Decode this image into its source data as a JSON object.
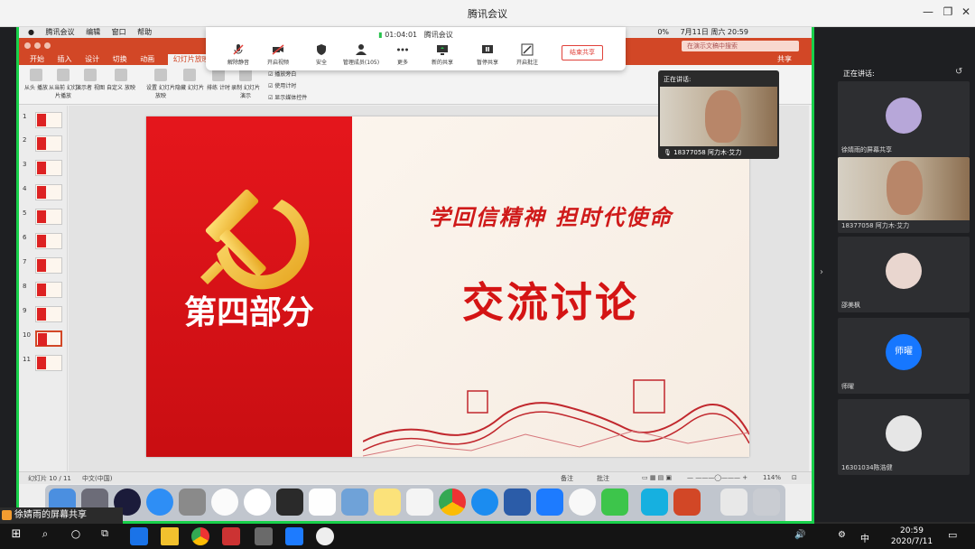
{
  "window": {
    "title": "腾讯会议"
  },
  "mac_menubar": {
    "items": [
      "腾讯会议",
      "编辑",
      "窗口",
      "帮助"
    ],
    "status": "0%",
    "datetime": "7月11日 周六  20:59"
  },
  "ppt": {
    "search_placeholder": "在演示文稿中搜索",
    "share_label": "共享",
    "tabs": [
      "开始",
      "插入",
      "设计",
      "切换",
      "动画",
      "幻灯片放映"
    ],
    "ribbon": [
      {
        "label": "从头\n播放"
      },
      {
        "label": "从当前\n幻灯片播放"
      },
      {
        "label": "演示者\n视图"
      },
      {
        "label": "自定义\n放映"
      },
      {
        "label": "设置\n幻灯片放映"
      },
      {
        "label": "隐藏\n幻灯片"
      },
      {
        "label": "排练\n计时"
      },
      {
        "label": "录制\n幻灯片演示"
      }
    ],
    "checkboxes": [
      "播放旁白",
      "使用计时",
      "显示媒体控件"
    ],
    "thumbnails": [
      "1",
      "2",
      "3",
      "4",
      "5",
      "6",
      "7",
      "8",
      "9",
      "10",
      "11"
    ],
    "selected_slide": 10,
    "status": {
      "slide_count": "幻灯片 10 / 11",
      "language": "中文(中国)",
      "notes": "备注",
      "comments": "批注",
      "zoom": "114%"
    }
  },
  "slide": {
    "part": "第四部分",
    "slogan": "学回信精神 担时代使命",
    "heading": "交流讨论"
  },
  "meeting_toolbar": {
    "timer": "01:04:01",
    "meeting_name": "腾讯会议",
    "buttons": [
      "解除静音",
      "开启视频",
      "安全",
      "管理成员(105)",
      "更多",
      "新的共享",
      "暂停共享",
      "开启批注"
    ],
    "end_share": "结束共享"
  },
  "floating_speaker": {
    "label": "正在讲话:",
    "name": "18377058 阿力木·艾力"
  },
  "right_panel": {
    "header": "正在讲话:",
    "tiles": [
      {
        "name": "徐婧雨的屏幕共享"
      },
      {
        "name": "18377058 阿力木·艾力"
      },
      {
        "name": "邵美枫"
      },
      {
        "name": "师曜",
        "avatar_text": "师曜"
      },
      {
        "name": "16301034陈浩健"
      }
    ]
  },
  "share_label": "徐婧雨的屏幕共享",
  "taskbar": {
    "ime": "中",
    "time": "20:59",
    "date": "2020/7/11"
  },
  "colors": {
    "accent_green": "#18d04a",
    "ppt_orange": "#d24726",
    "slide_red": "#d41414"
  }
}
